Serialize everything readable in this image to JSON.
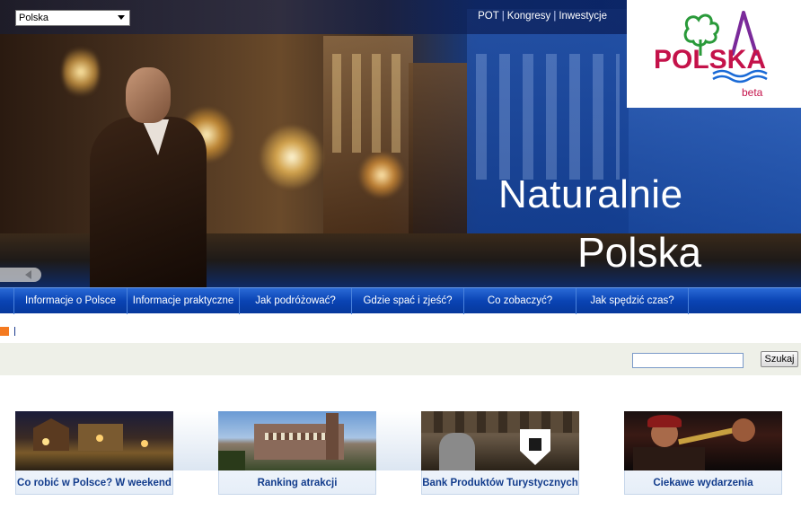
{
  "header": {
    "country_select": {
      "value": "Polska"
    },
    "top_links": [
      "POT",
      "Kongresy",
      "Inwestycje"
    ],
    "logo": {
      "text": "POLSKA",
      "badge": "beta"
    },
    "slogan": {
      "line1": "Naturalnie",
      "line2": "Polska"
    }
  },
  "nav": {
    "items": [
      "Informacje o Polsce",
      "Informacje praktyczne",
      "Jak podróżować?",
      "Gdzie spać i zjeść?",
      "Co zobaczyć?",
      "Jak spędzić czas?"
    ]
  },
  "search": {
    "input_value": "",
    "button_label": "Szukaj"
  },
  "cards": [
    {
      "caption": "Co robić w Polsce? W weekend"
    },
    {
      "caption": "Ranking atrakcji"
    },
    {
      "caption": "Bank Produktów Turystycznych"
    },
    {
      "caption": "Ciekawe wydarzenia"
    }
  ],
  "colors": {
    "nav_blue": "#0a44b4",
    "accent_orange": "#f47a20",
    "caption_blue": "#123c8c",
    "logo_red": "#c4124a",
    "logo_green": "#2a9a3a"
  }
}
